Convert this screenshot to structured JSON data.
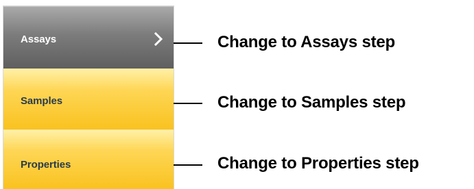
{
  "nav": {
    "items": [
      {
        "label": "Assays",
        "state": "active"
      },
      {
        "label": "Samples",
        "state": "step"
      },
      {
        "label": "Properties",
        "state": "step"
      }
    ],
    "active_indicator_icon": "chevron-right-icon"
  },
  "callouts": [
    {
      "text": "Change to Assays step"
    },
    {
      "text": "Change to Samples step"
    },
    {
      "text": "Change to Properties step"
    }
  ],
  "colors": {
    "active_item": "#7c7c7c",
    "step_item": "#fed655",
    "step_label": "#2a3b4c",
    "active_label": "#ffffff",
    "callout": "#000000"
  }
}
